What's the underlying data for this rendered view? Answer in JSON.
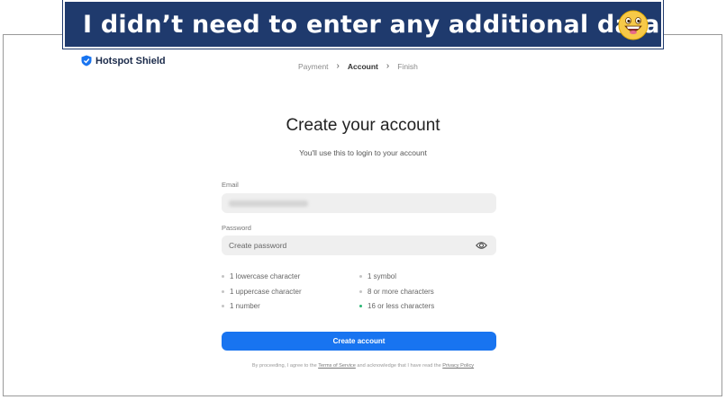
{
  "banner": {
    "text": "I didn’t need to enter any additional data",
    "emoji": "grinning-face-icon"
  },
  "logo": {
    "text": "Hotspot Shield"
  },
  "steps": [
    {
      "label": "Payment",
      "active": false
    },
    {
      "label": "Account",
      "active": true
    },
    {
      "label": "Finish",
      "active": false
    }
  ],
  "form": {
    "title": "Create your account",
    "subtitle": "You'll use this to login to your account",
    "email_label": "Email",
    "password_label": "Password",
    "password_placeholder": "Create password",
    "requirements_left": [
      "1 lowercase character",
      "1 uppercase character",
      "1 number"
    ],
    "requirements_right": [
      "1 symbol",
      "8 or more characters",
      "16 or less characters"
    ],
    "submit_label": "Create account"
  },
  "legal": {
    "prefix": "By proceeding, I agree to the",
    "terms": "Terms of Service",
    "middle": "and acknowledge that I have read the",
    "privacy": "Privacy Policy"
  },
  "colors": {
    "accent": "#1874f0",
    "banner": "#1f3a6d",
    "ok": "#2bb673"
  }
}
